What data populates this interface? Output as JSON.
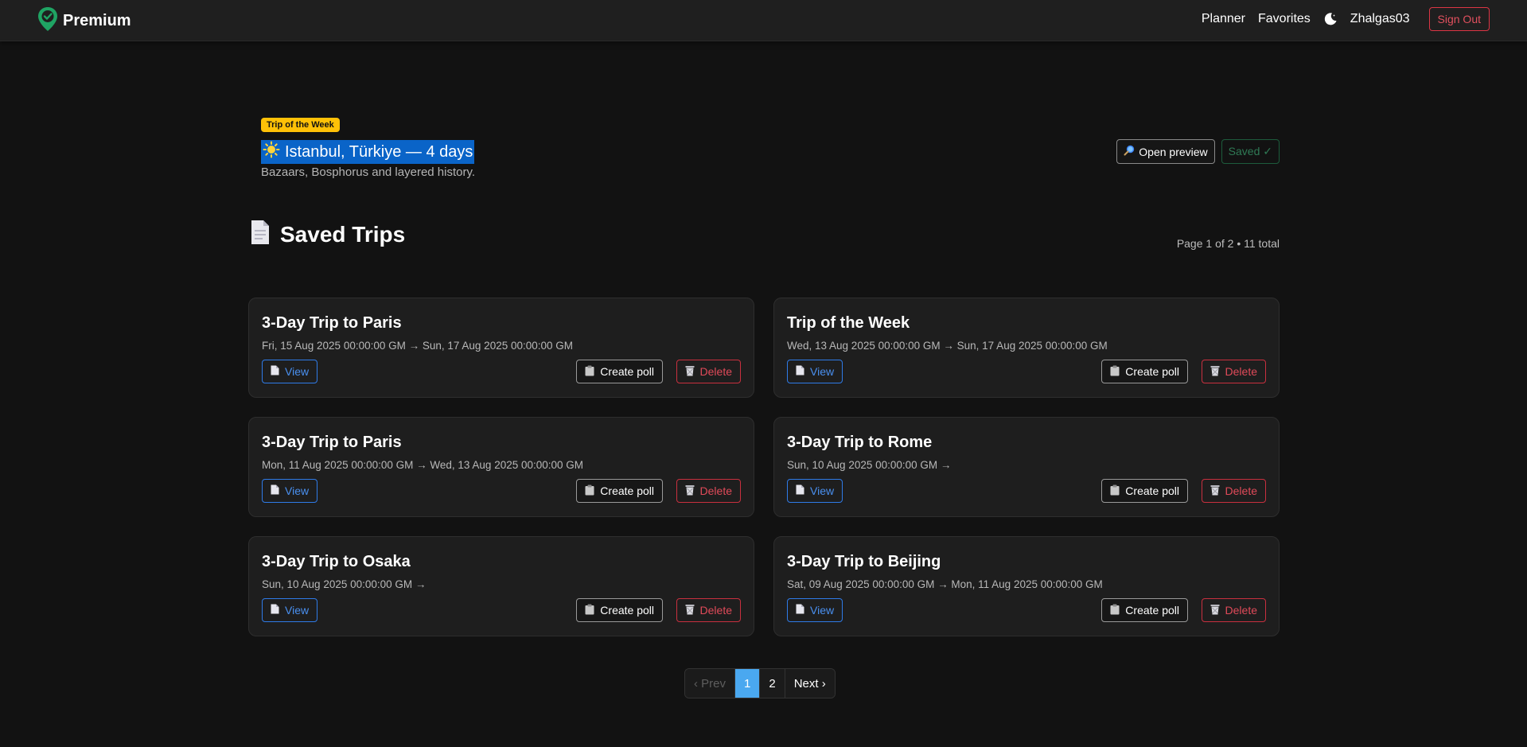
{
  "navbar": {
    "brand": "Premium",
    "links": [
      "Planner",
      "Favorites"
    ],
    "username": "Zhalgas03",
    "signout_label": "Sign Out"
  },
  "hero": {
    "badge": "Trip of the Week",
    "title": "Istanbul, Türkiye — 4 days",
    "subtitle": "Bazaars, Bosphorus and layered history.",
    "preview_label": "Open preview",
    "saved_label": "Saved ✓"
  },
  "saved": {
    "title": "Saved Trips",
    "page_info": "Page 1 of 2 • 11 total"
  },
  "card_actions": {
    "view": "View",
    "poll": "Create poll",
    "delete": "Delete"
  },
  "trips": [
    {
      "title": "3-Day Trip to Paris",
      "dates": "Fri, 15 Aug 2025 00:00:00 GM → Sun, 17 Aug 2025 00:00:00 GM"
    },
    {
      "title": "Trip of the Week",
      "dates": "Wed, 13 Aug 2025 00:00:00 GM → Sun, 17 Aug 2025 00:00:00 GM"
    },
    {
      "title": "3-Day Trip to Paris",
      "dates": "Mon, 11 Aug 2025 00:00:00 GM → Wed, 13 Aug 2025 00:00:00 GM"
    },
    {
      "title": "3-Day Trip to Rome",
      "dates": "Sun, 10 Aug 2025 00:00:00 GM →"
    },
    {
      "title": "3-Day Trip to Osaka",
      "dates": "Sun, 10 Aug 2025 00:00:00 GM →"
    },
    {
      "title": "3-Day Trip to Beijing",
      "dates": "Sat, 09 Aug 2025 00:00:00 GM → Mon, 11 Aug 2025 00:00:00 GM"
    }
  ],
  "pagination": {
    "prev": "‹ Prev",
    "pages": [
      "1",
      "2"
    ],
    "next": "Next ›",
    "current": "1"
  },
  "colors": {
    "background": "#121212",
    "navbar": "#1f1f1f",
    "card": "#1e1e1e",
    "badge": "#ffc107",
    "accent_blue": "#2f7be8",
    "danger": "#dc3545",
    "success": "#2f7a55",
    "active_page": "#4aa8f0"
  },
  "icons": {
    "brand": "location-pin-check-icon",
    "theme": "moon-icon",
    "hero": "sun-icon",
    "preview": "magnifier-icon",
    "section": "document-icon",
    "view": "page-icon",
    "poll": "clipboard-icon",
    "delete": "wastebasket-icon"
  }
}
